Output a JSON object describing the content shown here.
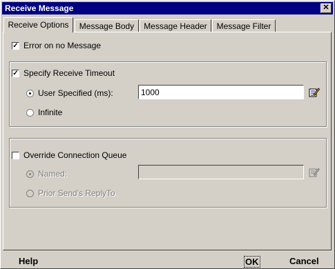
{
  "window": {
    "title": "Receive Message",
    "close_symbol": "✕"
  },
  "tabs": [
    {
      "label": "Receive Options",
      "active": true
    },
    {
      "label": "Message Body",
      "active": false
    },
    {
      "label": "Message Header",
      "active": false
    },
    {
      "label": "Message Filter",
      "active": false
    }
  ],
  "options": {
    "error_on_no_message": {
      "label": "Error on no Message",
      "checked": true
    }
  },
  "timeout": {
    "label": "Specify Receive Timeout",
    "checked": true,
    "user_specified_label": "User Specified (ms):",
    "user_specified_selected": true,
    "value": "1000",
    "infinite_label": "Infinite",
    "infinite_selected": false
  },
  "queue": {
    "label": "Override Connection Queue",
    "checked": false,
    "named_label": "Named:",
    "named_selected": true,
    "named_value": "",
    "reply_to_label": "Prior Send's ReplyTo",
    "reply_to_selected": false,
    "enabled": false
  },
  "buttons": {
    "help": "Help",
    "ok": "OK",
    "cancel": "Cancel"
  },
  "icons": {
    "edit": "edit-pencil-icon"
  }
}
